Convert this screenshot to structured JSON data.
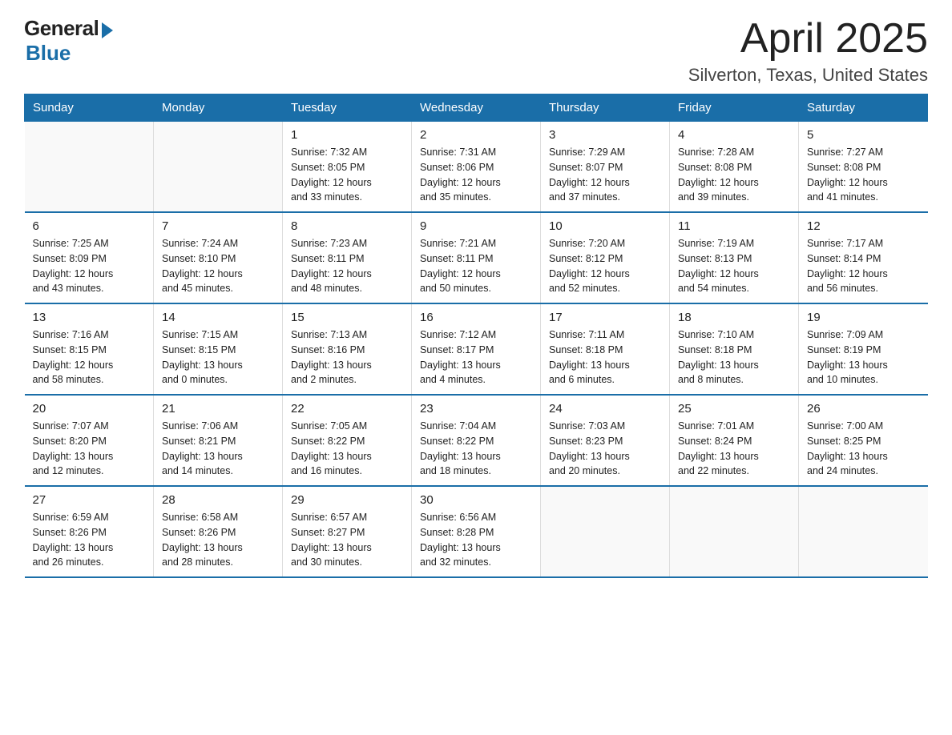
{
  "logo": {
    "general": "General",
    "blue": "Blue"
  },
  "title": "April 2025",
  "location": "Silverton, Texas, United States",
  "days_of_week": [
    "Sunday",
    "Monday",
    "Tuesday",
    "Wednesday",
    "Thursday",
    "Friday",
    "Saturday"
  ],
  "weeks": [
    [
      {
        "day": "",
        "info": ""
      },
      {
        "day": "",
        "info": ""
      },
      {
        "day": "1",
        "info": "Sunrise: 7:32 AM\nSunset: 8:05 PM\nDaylight: 12 hours\nand 33 minutes."
      },
      {
        "day": "2",
        "info": "Sunrise: 7:31 AM\nSunset: 8:06 PM\nDaylight: 12 hours\nand 35 minutes."
      },
      {
        "day": "3",
        "info": "Sunrise: 7:29 AM\nSunset: 8:07 PM\nDaylight: 12 hours\nand 37 minutes."
      },
      {
        "day": "4",
        "info": "Sunrise: 7:28 AM\nSunset: 8:08 PM\nDaylight: 12 hours\nand 39 minutes."
      },
      {
        "day": "5",
        "info": "Sunrise: 7:27 AM\nSunset: 8:08 PM\nDaylight: 12 hours\nand 41 minutes."
      }
    ],
    [
      {
        "day": "6",
        "info": "Sunrise: 7:25 AM\nSunset: 8:09 PM\nDaylight: 12 hours\nand 43 minutes."
      },
      {
        "day": "7",
        "info": "Sunrise: 7:24 AM\nSunset: 8:10 PM\nDaylight: 12 hours\nand 45 minutes."
      },
      {
        "day": "8",
        "info": "Sunrise: 7:23 AM\nSunset: 8:11 PM\nDaylight: 12 hours\nand 48 minutes."
      },
      {
        "day": "9",
        "info": "Sunrise: 7:21 AM\nSunset: 8:11 PM\nDaylight: 12 hours\nand 50 minutes."
      },
      {
        "day": "10",
        "info": "Sunrise: 7:20 AM\nSunset: 8:12 PM\nDaylight: 12 hours\nand 52 minutes."
      },
      {
        "day": "11",
        "info": "Sunrise: 7:19 AM\nSunset: 8:13 PM\nDaylight: 12 hours\nand 54 minutes."
      },
      {
        "day": "12",
        "info": "Sunrise: 7:17 AM\nSunset: 8:14 PM\nDaylight: 12 hours\nand 56 minutes."
      }
    ],
    [
      {
        "day": "13",
        "info": "Sunrise: 7:16 AM\nSunset: 8:15 PM\nDaylight: 12 hours\nand 58 minutes."
      },
      {
        "day": "14",
        "info": "Sunrise: 7:15 AM\nSunset: 8:15 PM\nDaylight: 13 hours\nand 0 minutes."
      },
      {
        "day": "15",
        "info": "Sunrise: 7:13 AM\nSunset: 8:16 PM\nDaylight: 13 hours\nand 2 minutes."
      },
      {
        "day": "16",
        "info": "Sunrise: 7:12 AM\nSunset: 8:17 PM\nDaylight: 13 hours\nand 4 minutes."
      },
      {
        "day": "17",
        "info": "Sunrise: 7:11 AM\nSunset: 8:18 PM\nDaylight: 13 hours\nand 6 minutes."
      },
      {
        "day": "18",
        "info": "Sunrise: 7:10 AM\nSunset: 8:18 PM\nDaylight: 13 hours\nand 8 minutes."
      },
      {
        "day": "19",
        "info": "Sunrise: 7:09 AM\nSunset: 8:19 PM\nDaylight: 13 hours\nand 10 minutes."
      }
    ],
    [
      {
        "day": "20",
        "info": "Sunrise: 7:07 AM\nSunset: 8:20 PM\nDaylight: 13 hours\nand 12 minutes."
      },
      {
        "day": "21",
        "info": "Sunrise: 7:06 AM\nSunset: 8:21 PM\nDaylight: 13 hours\nand 14 minutes."
      },
      {
        "day": "22",
        "info": "Sunrise: 7:05 AM\nSunset: 8:22 PM\nDaylight: 13 hours\nand 16 minutes."
      },
      {
        "day": "23",
        "info": "Sunrise: 7:04 AM\nSunset: 8:22 PM\nDaylight: 13 hours\nand 18 minutes."
      },
      {
        "day": "24",
        "info": "Sunrise: 7:03 AM\nSunset: 8:23 PM\nDaylight: 13 hours\nand 20 minutes."
      },
      {
        "day": "25",
        "info": "Sunrise: 7:01 AM\nSunset: 8:24 PM\nDaylight: 13 hours\nand 22 minutes."
      },
      {
        "day": "26",
        "info": "Sunrise: 7:00 AM\nSunset: 8:25 PM\nDaylight: 13 hours\nand 24 minutes."
      }
    ],
    [
      {
        "day": "27",
        "info": "Sunrise: 6:59 AM\nSunset: 8:26 PM\nDaylight: 13 hours\nand 26 minutes."
      },
      {
        "day": "28",
        "info": "Sunrise: 6:58 AM\nSunset: 8:26 PM\nDaylight: 13 hours\nand 28 minutes."
      },
      {
        "day": "29",
        "info": "Sunrise: 6:57 AM\nSunset: 8:27 PM\nDaylight: 13 hours\nand 30 minutes."
      },
      {
        "day": "30",
        "info": "Sunrise: 6:56 AM\nSunset: 8:28 PM\nDaylight: 13 hours\nand 32 minutes."
      },
      {
        "day": "",
        "info": ""
      },
      {
        "day": "",
        "info": ""
      },
      {
        "day": "",
        "info": ""
      }
    ]
  ]
}
